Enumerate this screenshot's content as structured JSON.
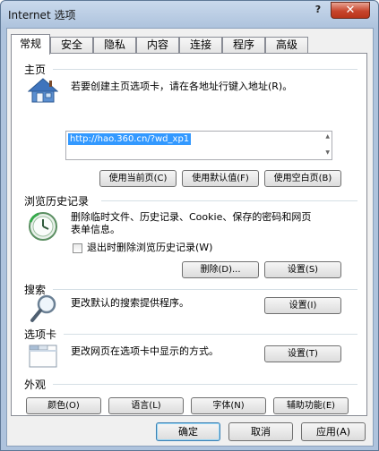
{
  "window": {
    "title": "Internet 选项",
    "help_label": "?",
    "close_label": "✕"
  },
  "tabs": [
    {
      "label": "常规"
    },
    {
      "label": "安全"
    },
    {
      "label": "隐私"
    },
    {
      "label": "内容"
    },
    {
      "label": "连接"
    },
    {
      "label": "程序"
    },
    {
      "label": "高级"
    }
  ],
  "home": {
    "title": "主页",
    "description": "若要创建主页选项卡，请在各地址行键入地址(R)。",
    "url": "http://hao.360.cn/?wd_xp1",
    "buttons": {
      "current": "使用当前页(C)",
      "default": "使用默认值(F)",
      "blank": "使用空白页(B)"
    }
  },
  "history": {
    "title": "浏览历史记录",
    "description_line1": "删除临时文件、历史记录、Cookie、保存的密码和网页",
    "description_line2": "表单信息。",
    "checkbox_label": "退出时删除浏览历史记录(W)",
    "checkbox_checked": false,
    "buttons": {
      "delete": "删除(D)...",
      "settings": "设置(S)"
    }
  },
  "search": {
    "title": "搜索",
    "description": "更改默认的搜索提供程序。",
    "settings": "设置(I)"
  },
  "tabs_section": {
    "title": "选项卡",
    "description": "更改网页在选项卡中显示的方式。",
    "settings": "设置(T)"
  },
  "appearance": {
    "title": "外观",
    "buttons": {
      "colors": "颜色(O)",
      "languages": "语言(L)",
      "fonts": "字体(N)",
      "accessibility": "辅助功能(E)"
    }
  },
  "footer": {
    "ok": "确定",
    "cancel": "取消",
    "apply": "应用(A)"
  },
  "icons": {
    "home": "house-icon",
    "history": "clock-icon",
    "search": "magnifier-icon",
    "tabs": "tabbed-window-icon"
  }
}
